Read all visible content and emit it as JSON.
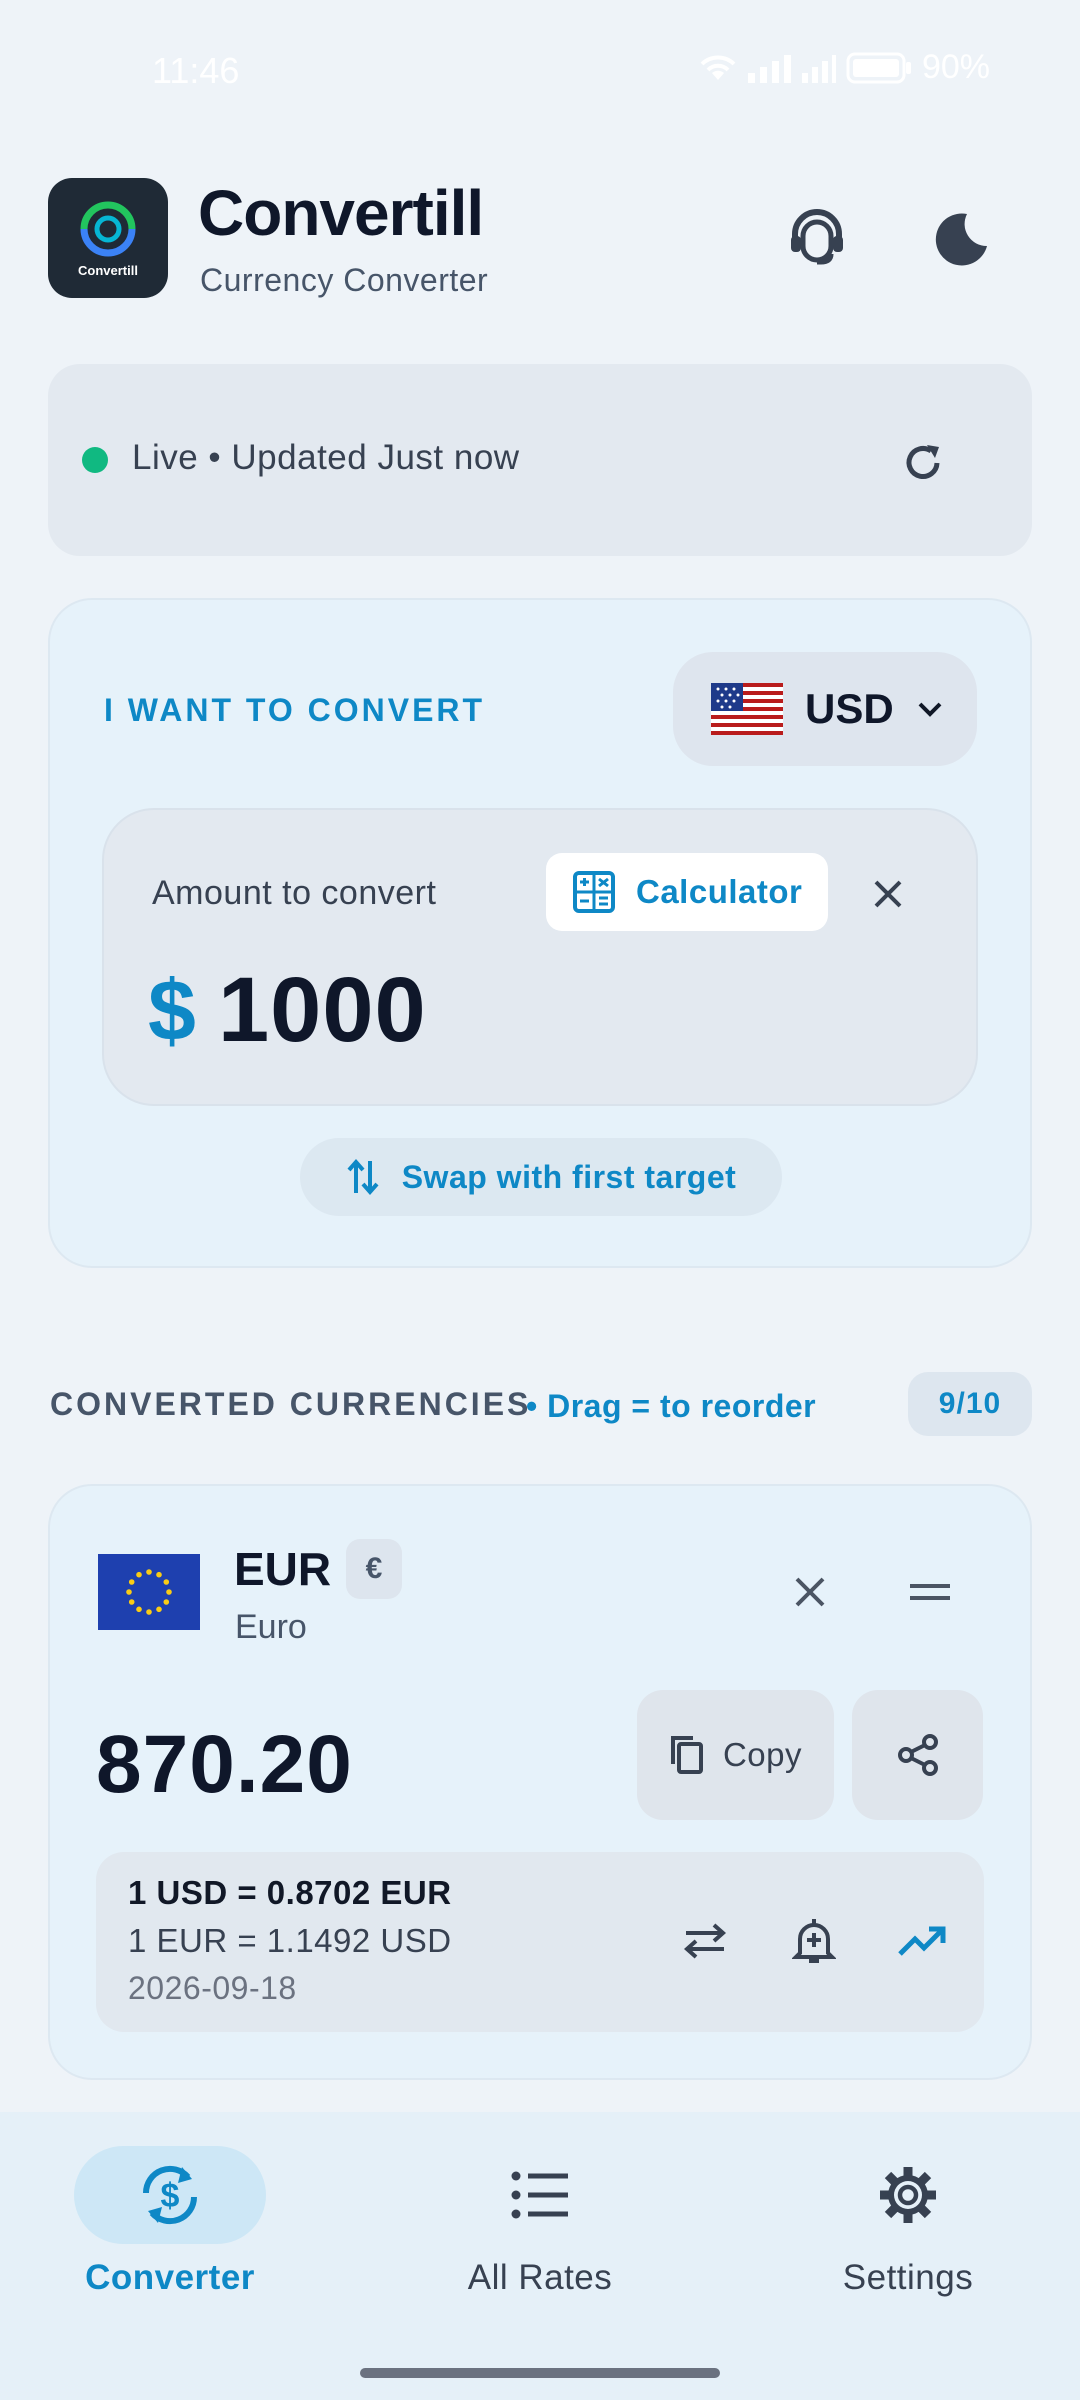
{
  "status_bar": {
    "time": "11:46",
    "battery": "90%"
  },
  "header": {
    "app_name": "Convertill",
    "subtitle": "Currency Converter",
    "logo_text": "Convertill",
    "support_icon": "headset-icon",
    "theme_icon": "moon-icon"
  },
  "live": {
    "text": "Live • Updated Just now",
    "status_color": "#10b981",
    "refresh_icon": "refresh-icon"
  },
  "converter": {
    "label": "I WANT TO CONVERT",
    "base_currency": "USD",
    "base_flag": "🇺🇸",
    "amount_label": "Amount to convert",
    "calculator_label": "Calculator",
    "currency_symbol": "$",
    "amount": "1000",
    "swap_label": "Swap with first target"
  },
  "converted": {
    "section_title": "CONVERTED CURRENCIES",
    "hint": "• Drag = to reorder",
    "count": "9/10",
    "items": [
      {
        "code": "EUR",
        "symbol": "€",
        "name": "Euro",
        "amount": "870.20",
        "copy_label": "Copy",
        "rate": "1 USD = 0.8702 EUR",
        "inverse_rate": "1 EUR = 1.1492 USD",
        "date": "2026-09-18"
      }
    ]
  },
  "nav": {
    "items": [
      {
        "label": "Converter",
        "icon": "currency-exchange-icon",
        "active": true
      },
      {
        "label": "All Rates",
        "icon": "list-icon",
        "active": false
      },
      {
        "label": "Settings",
        "icon": "gear-icon",
        "active": false
      }
    ]
  },
  "colors": {
    "accent": "#0e88c6",
    "background": "#eef3f8",
    "card": "#e6f2fa",
    "text_primary": "#0f172a"
  }
}
